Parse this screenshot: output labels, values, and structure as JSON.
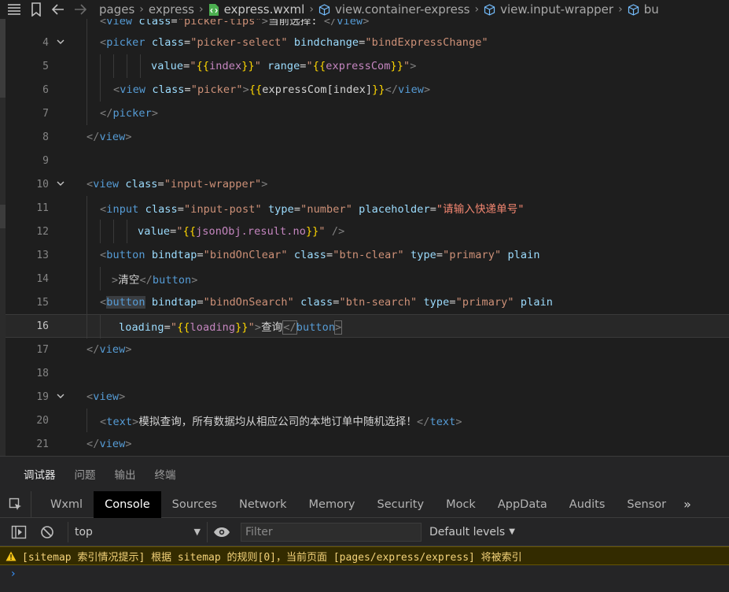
{
  "breadcrumb": {
    "items": [
      "pages",
      "express",
      "express.wxml",
      "view.container-express",
      "view.input-wrapper",
      "bu"
    ]
  },
  "editor": {
    "lines": [
      {
        "n": "",
        "fold": false
      },
      {
        "n": "4",
        "fold": true
      },
      {
        "n": "5",
        "fold": false
      },
      {
        "n": "6",
        "fold": false
      },
      {
        "n": "7",
        "fold": false
      },
      {
        "n": "8",
        "fold": false
      },
      {
        "n": "9",
        "fold": false
      },
      {
        "n": "10",
        "fold": true
      },
      {
        "n": "11",
        "fold": false
      },
      {
        "n": "12",
        "fold": false
      },
      {
        "n": "13",
        "fold": false
      },
      {
        "n": "14",
        "fold": false
      },
      {
        "n": "15",
        "fold": false
      },
      {
        "n": "16",
        "fold": false
      },
      {
        "n": "17",
        "fold": false
      },
      {
        "n": "18",
        "fold": false
      },
      {
        "n": "19",
        "fold": true
      },
      {
        "n": "20",
        "fold": false
      },
      {
        "n": "21",
        "fold": false
      }
    ],
    "code": {
      "l3": "<view class=\"picker-tips\">当前选择: </view>",
      "l4": "<picker class=\"picker-select\" bindchange=\"bindExpressChange\"",
      "l5": "value=\"{{index}}\" range=\"{{expressCom}}\">",
      "l6": "<view class=\"picker\">{{expressCom[index]}}</view>",
      "l7": "</picker>",
      "l8": "</view>",
      "l10": "<view class=\"input-wrapper\">",
      "l11": "<input class=\"input-post\" type=\"number\" placeholder=\"请输入快递单号\"",
      "l12": "value=\"{{jsonObj.result.no}}\" />",
      "l13": "<button bindtap=\"bindOnClear\" class=\"btn-clear\" type=\"primary\" plain",
      "l14": ">清空</button>",
      "l15": "<button bindtap=\"bindOnSearch\" class=\"btn-search\" type=\"primary\" plain",
      "l16": "loading=\"{{loading}}\">查询</button>",
      "l17": "</view>",
      "l19": "<view>",
      "l20": "<text>模拟查询，所有数据均从相应公司的本地订单中随机选择！</text>",
      "l21": "</view>"
    }
  },
  "panel": {
    "tabs": [
      "调试器",
      "问题",
      "输出",
      "终端"
    ],
    "devtools_tabs": [
      "Wxml",
      "Console",
      "Sources",
      "Network",
      "Memory",
      "Security",
      "Mock",
      "AppData",
      "Audits",
      "Sensor"
    ],
    "more": "»",
    "context": "top",
    "filter_placeholder": "Filter",
    "levels": "Default levels",
    "warning": "[sitemap 索引情况提示] 根据 sitemap 的规则[0]，当前页面 [pages/express/express] 将被索引",
    "prompt": "›"
  },
  "colors": {
    "accent": "#569cd6",
    "warning_bg": "#332b00",
    "warning_text": "#f3d27a"
  }
}
